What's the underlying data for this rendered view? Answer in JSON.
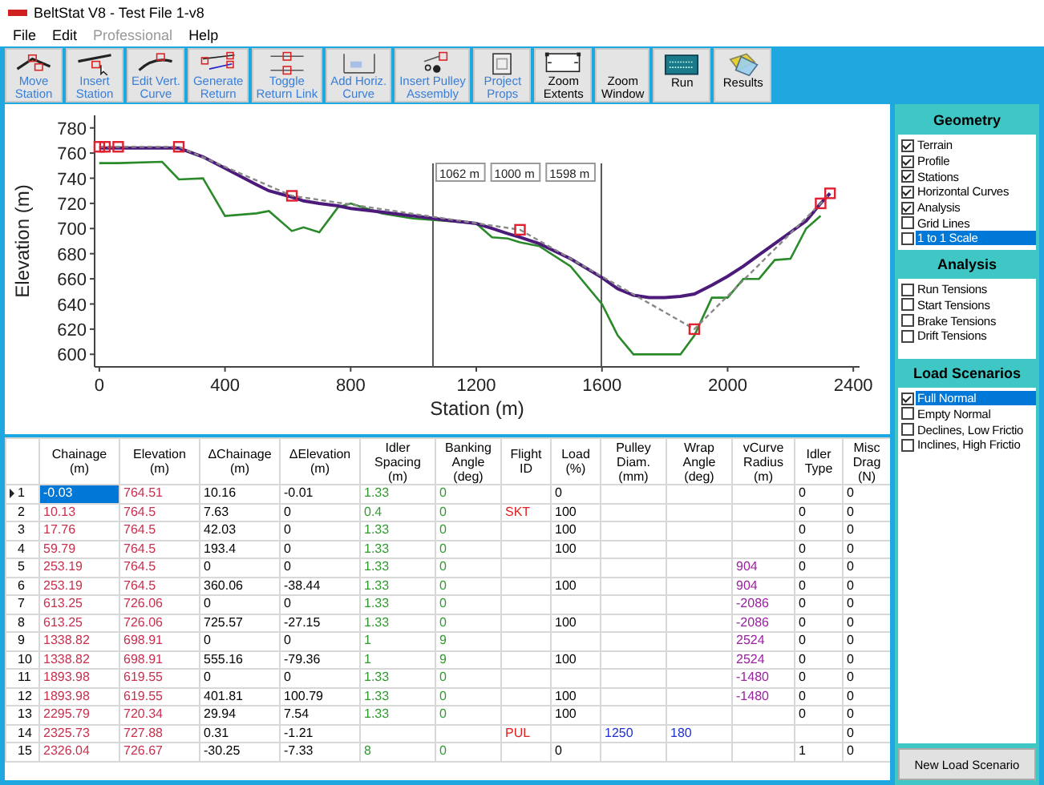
{
  "window": {
    "title": "BeltStat V8 - Test File 1-v8"
  },
  "menu": [
    {
      "label": "File",
      "disabled": false
    },
    {
      "label": "Edit",
      "disabled": false
    },
    {
      "label": "Professional",
      "disabled": true
    },
    {
      "label": "Help",
      "disabled": false
    }
  ],
  "toolbar": [
    {
      "label": "Move\nStation",
      "accent": true
    },
    {
      "label": "Insert\nStation",
      "accent": true
    },
    {
      "label": "Edit Vert.\nCurve",
      "accent": true
    },
    {
      "label": "Generate\nReturn",
      "accent": true
    },
    {
      "label": "Toggle\nReturn Link",
      "accent": true
    },
    {
      "label": "Add Horiz.\nCurve",
      "accent": true
    },
    {
      "label": "Insert Pulley\nAssembly",
      "accent": true
    },
    {
      "label": "Project\nProps",
      "accent": true
    },
    {
      "label": "Zoom\nExtents",
      "accent": false
    },
    {
      "label": "Zoom\nWindow",
      "accent": false
    },
    {
      "label": "Run",
      "accent": false
    },
    {
      "label": "Results",
      "accent": false
    }
  ],
  "chart": {
    "chart_data": {
      "type": "line",
      "xlabel": "Station (m)",
      "ylabel": "Elevation (m)",
      "x": [
        0,
        10,
        18,
        50,
        60,
        200,
        253,
        330,
        400,
        500,
        540,
        613,
        650,
        700,
        760,
        800,
        900,
        1000,
        1100,
        1200,
        1250,
        1300,
        1339,
        1400,
        1500,
        1600,
        1650,
        1700,
        1750,
        1800,
        1850,
        1894,
        1950,
        2000,
        2050,
        2100,
        2150,
        2200,
        2250,
        2296,
        2326
      ],
      "series": [
        {
          "color": "#2a8a2a",
          "line_style": "solid",
          "values": [
            752,
            752,
            752,
            752,
            752,
            753,
            739,
            740,
            710,
            712,
            714,
            698,
            701,
            697,
            717,
            720,
            712,
            708,
            706,
            704,
            693,
            692,
            689,
            686,
            670,
            640,
            615,
            600,
            600,
            600,
            600,
            615,
            645,
            645,
            660,
            660,
            675,
            676,
            700,
            710,
            null
          ]
        },
        {
          "color": "#4b1a7a",
          "line_style": "solid",
          "values": [
            764,
            764,
            764,
            764,
            764,
            764,
            764,
            757,
            748,
            735,
            730,
            725,
            722,
            720,
            718,
            716,
            713,
            710,
            707,
            704,
            700,
            696,
            693,
            688,
            676,
            661,
            652,
            647,
            645,
            645,
            646,
            648,
            655,
            662,
            670,
            679,
            688,
            697,
            706,
            720,
            728
          ]
        },
        {
          "color": "#888888",
          "line_style": "dashed",
          "marker": "square",
          "values": [
            765,
            null,
            765,
            null,
            765,
            null,
            765,
            null,
            null,
            null,
            null,
            726,
            null,
            null,
            null,
            null,
            null,
            null,
            null,
            null,
            null,
            null,
            699,
            null,
            null,
            null,
            null,
            null,
            null,
            null,
            null,
            620,
            null,
            null,
            null,
            null,
            null,
            null,
            null,
            720,
            728
          ]
        }
      ],
      "xlim": [
        -15,
        2420
      ],
      "ylim": [
        590,
        790
      ],
      "xticks": [
        0,
        400,
        800,
        1200,
        1600,
        2000,
        2400
      ],
      "yticks": [
        600,
        620,
        640,
        660,
        680,
        700,
        720,
        740,
        760,
        780
      ],
      "ref_lines": [
        {
          "axis": "x",
          "value": 1062,
          "label": "1062 m"
        },
        {
          "axis": "x",
          "value": 1598,
          "label": "1598 m"
        }
      ],
      "annotations": [
        {
          "text": "1000 m"
        }
      ]
    }
  },
  "table": {
    "columns": [
      {
        "label": "Chainage\n(m)",
        "color": "#c8304e"
      },
      {
        "label": "Elevation\n(m)",
        "color": "#c8304e"
      },
      {
        "label": "ΔChainage\n(m)",
        "color": "#000000"
      },
      {
        "label": "ΔElevation\n(m)",
        "color": "#000000"
      },
      {
        "label": "Idler\nSpacing\n(m)",
        "color": "#2e9a2e"
      },
      {
        "label": "Banking\nAngle\n(deg)",
        "color": "#2e9a2e"
      },
      {
        "label": "Flight\nID",
        "color": "#e02020"
      },
      {
        "label": "Load\n(%)",
        "color": "#000000"
      },
      {
        "label": "Pulley\nDiam.\n(mm)",
        "color": "#2030d0"
      },
      {
        "label": "Wrap\nAngle\n(deg)",
        "color": "#2030d0"
      },
      {
        "label": "vCurve\nRadius\n(m)",
        "color": "#9a20a0"
      },
      {
        "label": "Idler\nType",
        "color": "#000000"
      },
      {
        "label": "Misc\nDrag\n(N)",
        "color": "#000000"
      }
    ],
    "rows": [
      {
        "number": "1",
        "selected": true,
        "cells": [
          "-0.03",
          "764.51",
          "10.16",
          "-0.01",
          "1.33",
          "0",
          "",
          "0",
          "",
          "",
          "",
          "0",
          "0"
        ]
      },
      {
        "number": "2",
        "selected": false,
        "cells": [
          "10.13",
          "764.5",
          "7.63",
          "0",
          "0.4",
          "0",
          "SKT",
          "100",
          "",
          "",
          "",
          "0",
          "0"
        ]
      },
      {
        "number": "3",
        "selected": false,
        "cells": [
          "17.76",
          "764.5",
          "42.03",
          "0",
          "1.33",
          "0",
          "",
          "100",
          "",
          "",
          "",
          "0",
          "0"
        ]
      },
      {
        "number": "4",
        "selected": false,
        "cells": [
          "59.79",
          "764.5",
          "193.4",
          "0",
          "1.33",
          "0",
          "",
          "100",
          "",
          "",
          "",
          "0",
          "0"
        ]
      },
      {
        "number": "5",
        "selected": false,
        "cells": [
          "253.19",
          "764.5",
          "0",
          "0",
          "1.33",
          "0",
          "",
          "",
          "",
          "",
          "904",
          "0",
          "0"
        ]
      },
      {
        "number": "6",
        "selected": false,
        "cells": [
          "253.19",
          "764.5",
          "360.06",
          "-38.44",
          "1.33",
          "0",
          "",
          "100",
          "",
          "",
          "904",
          "0",
          "0"
        ]
      },
      {
        "number": "7",
        "selected": false,
        "cells": [
          "613.25",
          "726.06",
          "0",
          "0",
          "1.33",
          "0",
          "",
          "",
          "",
          "",
          "-2086",
          "0",
          "0"
        ]
      },
      {
        "number": "8",
        "selected": false,
        "cells": [
          "613.25",
          "726.06",
          "725.57",
          "-27.15",
          "1.33",
          "0",
          "",
          "100",
          "",
          "",
          "-2086",
          "0",
          "0"
        ]
      },
      {
        "number": "9",
        "selected": false,
        "cells": [
          "1338.82",
          "698.91",
          "0",
          "0",
          "1",
          "9",
          "",
          "",
          "",
          "",
          "2524",
          "0",
          "0"
        ]
      },
      {
        "number": "10",
        "selected": false,
        "cells": [
          "1338.82",
          "698.91",
          "555.16",
          "-79.36",
          "1",
          "9",
          "",
          "100",
          "",
          "",
          "2524",
          "0",
          "0"
        ]
      },
      {
        "number": "11",
        "selected": false,
        "cells": [
          "1893.98",
          "619.55",
          "0",
          "0",
          "1.33",
          "0",
          "",
          "",
          "",
          "",
          "-1480",
          "0",
          "0"
        ]
      },
      {
        "number": "12",
        "selected": false,
        "cells": [
          "1893.98",
          "619.55",
          "401.81",
          "100.79",
          "1.33",
          "0",
          "",
          "100",
          "",
          "",
          "-1480",
          "0",
          "0"
        ]
      },
      {
        "number": "13",
        "selected": false,
        "cells": [
          "2295.79",
          "720.34",
          "29.94",
          "7.54",
          "1.33",
          "0",
          "",
          "100",
          "",
          "",
          "",
          "0",
          "0"
        ]
      },
      {
        "number": "14",
        "selected": false,
        "cells": [
          "2325.73",
          "727.88",
          "0.31",
          "-1.21",
          "",
          "",
          "PUL",
          "",
          "1250",
          "180",
          "",
          "",
          "0"
        ]
      },
      {
        "number": "15",
        "selected": false,
        "cells": [
          "2326.04",
          "726.67",
          "-30.25",
          "-7.33",
          "8",
          "0",
          "",
          "0",
          "",
          "",
          "",
          "1",
          "0"
        ]
      }
    ]
  },
  "side_panel": {
    "sections": [
      {
        "title": "Geometry",
        "items": [
          {
            "label": "Terrain",
            "checked": true,
            "selected": false
          },
          {
            "label": "Profile",
            "checked": true,
            "selected": false
          },
          {
            "label": "Stations",
            "checked": true,
            "selected": false
          },
          {
            "label": "Horizontal Curves",
            "checked": true,
            "selected": false
          },
          {
            "label": "Analysis",
            "checked": true,
            "selected": false
          },
          {
            "label": "Grid Lines",
            "checked": false,
            "selected": false
          },
          {
            "label": "1 to 1 Scale",
            "checked": false,
            "selected": true
          }
        ]
      },
      {
        "title": "Analysis",
        "items": [
          {
            "label": "Run Tensions",
            "checked": false,
            "selected": false
          },
          {
            "label": "Start Tensions",
            "checked": false,
            "selected": false
          },
          {
            "label": "Brake Tensions",
            "checked": false,
            "selected": false
          },
          {
            "label": "Drift Tensions",
            "checked": false,
            "selected": false
          }
        ]
      },
      {
        "title": "Load Scenarios",
        "items": [
          {
            "label": "Full Normal",
            "checked": true,
            "selected": true
          },
          {
            "label": "Empty Normal",
            "checked": false,
            "selected": false
          },
          {
            "label": "Declines, Low Frictio",
            "checked": false,
            "selected": false
          },
          {
            "label": "Inclines, High Frictio",
            "checked": false,
            "selected": false
          }
        ]
      }
    ],
    "button": "New Load Scenario"
  }
}
